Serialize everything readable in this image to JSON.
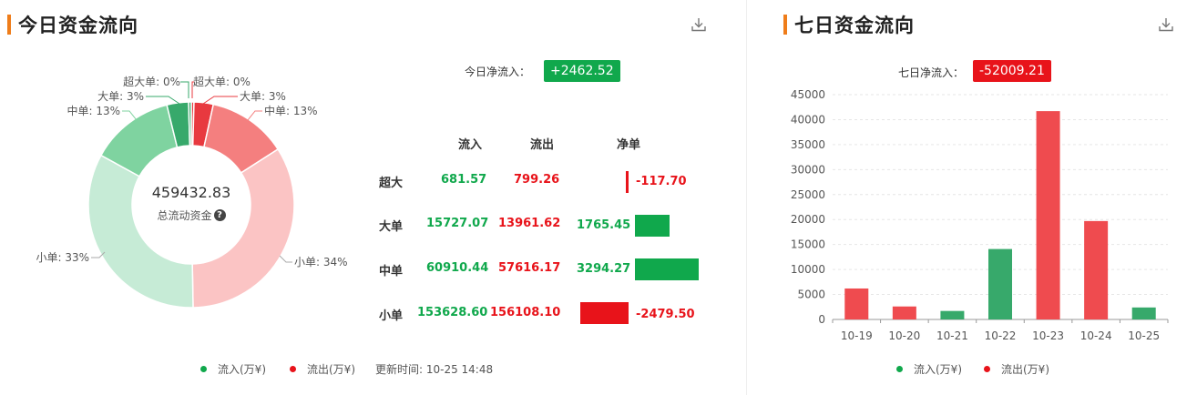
{
  "today": {
    "title": "今日资金流向",
    "net_label": "今日净流入：",
    "net_value": "+2462.52",
    "total_value": "459432.83",
    "total_label": "总流动资金",
    "help_icon": "question-circle-icon",
    "download_icon": "download-icon",
    "donut_labels": {
      "in_super": "超大单: 0%",
      "in_large": "大单: 3%",
      "in_medium": "中单: 13%",
      "in_small": "小单: 33%",
      "out_super": "超大单: 0%",
      "out_large": "大单: 3%",
      "out_medium": "中单: 13%",
      "out_small": "小单: 34%"
    },
    "table": {
      "headers": [
        "流入",
        "流出",
        "净单"
      ],
      "rows": [
        {
          "label": "超大",
          "inflow": "681.57",
          "outflow": "799.26",
          "net": "-117.70",
          "net_num": -117.7
        },
        {
          "label": "大单",
          "inflow": "15727.07",
          "outflow": "13961.62",
          "net": "1765.45",
          "net_num": 1765.45
        },
        {
          "label": "中单",
          "inflow": "60910.44",
          "outflow": "57616.17",
          "net": "3294.27",
          "net_num": 3294.27
        },
        {
          "label": "小单",
          "inflow": "153628.60",
          "outflow": "156108.10",
          "net": "-2479.50",
          "net_num": -2479.5
        }
      ]
    },
    "legend": {
      "inflow": "流入(万¥)",
      "outflow": "流出(万¥)",
      "updated": "更新时间: 10-25 14:48"
    }
  },
  "week": {
    "title": "七日资金流向",
    "net_label": "七日净流入：",
    "net_value": "-52009.21",
    "download_icon": "download-icon",
    "legend": {
      "inflow": "流入(万¥)",
      "outflow": "流出(万¥)"
    }
  },
  "colors": {
    "accent": "#ef7d1a",
    "in_dark": "#37a96b",
    "in_medium": "#7fd3a0",
    "in_light": "#c6ebd6",
    "out_dark": "#e8393f",
    "out_medium": "#f47f7f",
    "out_light": "#fbc4c4",
    "green": "#10a84c",
    "red": "#e8131a",
    "bar_green": "#37a96b",
    "bar_red": "#ef4b4f"
  },
  "chart_data": [
    {
      "type": "pie",
      "categories": [
        "超大单",
        "大单",
        "中单",
        "小单",
        "小单",
        "中单",
        "大单",
        "超大单"
      ],
      "values": [
        681.57,
        15727.07,
        60910.44,
        153628.6,
        156108.1,
        57616.17,
        13961.62,
        799.26
      ],
      "flows": [
        "in",
        "in",
        "in",
        "in",
        "out",
        "out",
        "out",
        "out"
      ],
      "percent_labels": [
        "0%",
        "3%",
        "13%",
        "33%",
        "34%",
        "13%",
        "3%",
        "0%"
      ],
      "total": 459432.83
    },
    {
      "type": "bar",
      "categories": [
        "10-19",
        "10-20",
        "10-21",
        "10-22",
        "10-23",
        "10-24",
        "10-25"
      ],
      "values": [
        6200,
        2600,
        1700,
        14100,
        41700,
        19700,
        2400
      ],
      "flows": [
        "out",
        "out",
        "in",
        "in",
        "out",
        "out",
        "in"
      ],
      "ylim": [
        0,
        45000
      ],
      "yticks": [
        0,
        5000,
        10000,
        15000,
        20000,
        25000,
        30000,
        35000,
        40000,
        45000
      ],
      "grid": true
    }
  ]
}
